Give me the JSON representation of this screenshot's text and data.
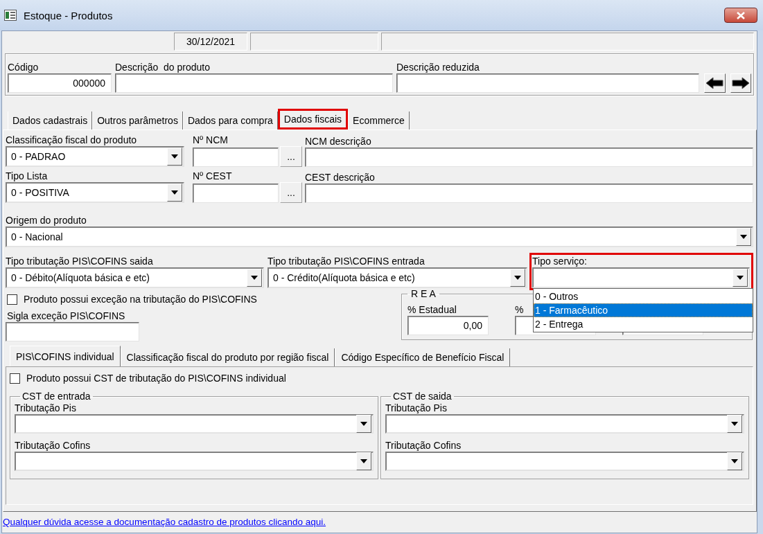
{
  "window": {
    "title": "Estoque - Produtos"
  },
  "status_bar": {
    "date": "30/12/2021"
  },
  "header": {
    "fields": [
      {
        "label": "Código",
        "value": "000000"
      },
      {
        "label": "Descrição  do produto"
      },
      {
        "label": "Descrição reduzida"
      }
    ]
  },
  "tabs": [
    {
      "label": "Dados cadastrais",
      "selected": false,
      "highlighted": false
    },
    {
      "label": "Outros parâmetros",
      "selected": false,
      "highlighted": false
    },
    {
      "label": "Dados para compra",
      "selected": false,
      "highlighted": false
    },
    {
      "label": "Dados fiscais",
      "selected": true,
      "highlighted": true
    },
    {
      "label": "Ecommerce",
      "selected": false,
      "highlighted": false
    }
  ],
  "fiscal": {
    "classificacao": {
      "label": "Classificação fiscal do produto",
      "value": "0 - PADRAO"
    },
    "ncm_number": {
      "label": "Nº NCM",
      "button": "..."
    },
    "ncm_description": {
      "label": "NCM descrição"
    },
    "tipo_lista": {
      "label": "Tipo Lista",
      "value": "0 - POSITIVA"
    },
    "cest_number": {
      "label": "Nº CEST",
      "button": "..."
    },
    "cest_description": {
      "label": "CEST descrição"
    },
    "origem": {
      "label": "Origem do produto",
      "value": "0 - Nacional"
    },
    "pis_cofins_saida": {
      "label": "Tipo tributação PIS\\COFINS saida",
      "value": "0 - Débito(Alíquota básica e etc)"
    },
    "pis_cofins_entrada": {
      "label": "Tipo tributação PIS\\COFINS entrada",
      "value": "0 - Crédito(Alíquota básica e etc)"
    },
    "tipo_servico": {
      "label": "Tipo serviço:",
      "highlighted": true,
      "expanded": true,
      "options": [
        {
          "label": "0 - Outros",
          "selected": false
        },
        {
          "label": "1 - Farmacêutico",
          "selected": true
        },
        {
          "label": "2 - Entrega",
          "selected": false
        }
      ]
    },
    "exception_checkbox": {
      "label": "Produto possui exceção na tributação do PIS\\COFINS",
      "checked": false
    },
    "sigla": {
      "label": "Sigla exceção PIS\\COFINS"
    },
    "rea": {
      "title": "R E A",
      "fields": [
        {
          "kind": "input",
          "label": "% Estadual",
          "value": "0,00"
        },
        {
          "kind": "input",
          "label": "%"
        },
        {
          "kind": "input"
        }
      ]
    }
  },
  "sub_tabs": [
    {
      "label": "PIS\\COFINS individual",
      "selected": true
    },
    {
      "label": "Classificação fiscal do produto por região fiscal",
      "selected": false
    },
    {
      "label": "Código Específico de Benefício Fiscal",
      "selected": false
    }
  ],
  "individual": {
    "checkbox": {
      "label": "Produto possui CST de tributação do PIS\\COFINS individual",
      "checked": false
    },
    "groups": [
      {
        "title": "CST de entrada",
        "fields": [
          {
            "label": "Tributação Pis"
          },
          {
            "label": "Tributação Cofins"
          }
        ]
      },
      {
        "title": "CST de saida",
        "fields": [
          {
            "label": "Tributação Pis"
          },
          {
            "label": "Tributação Cofins"
          }
        ]
      }
    ]
  },
  "help_link": "Qualquer dúvida acesse a documentação cadastro de produtos clicando aqui."
}
